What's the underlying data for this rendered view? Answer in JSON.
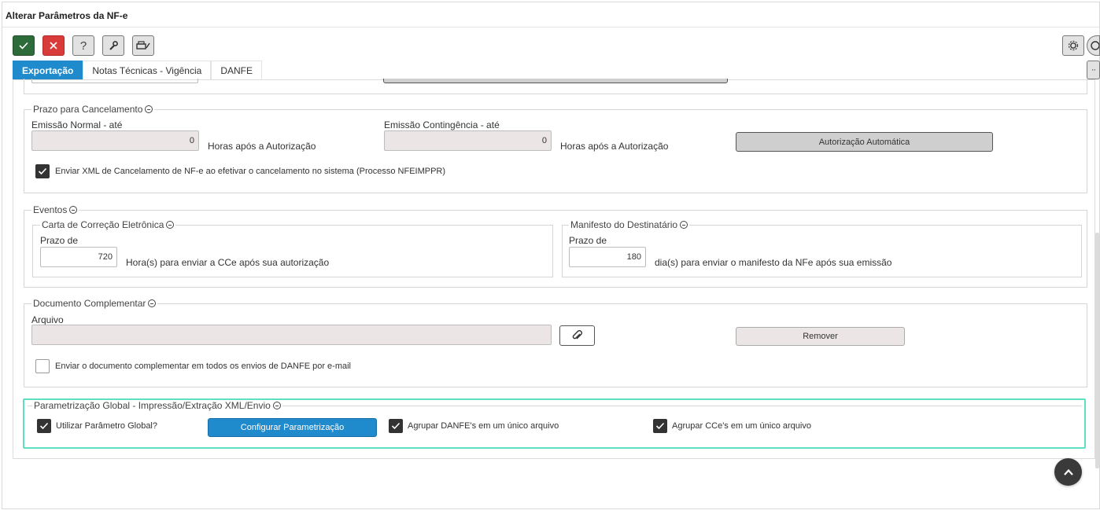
{
  "window": {
    "title": "Alterar Parâmetros da NF-e"
  },
  "toolbar": {
    "help_label": "?",
    "icons": [
      "check-icon",
      "close-icon",
      "help-icon",
      "wrench-icon",
      "printer-icon",
      "gear-icon",
      "search-icon",
      "more-icon"
    ]
  },
  "tabs": [
    {
      "label": "Exportação",
      "active": true
    },
    {
      "label": "Notas Técnicas - Vigência",
      "active": false
    },
    {
      "label": "DANFE",
      "active": false
    }
  ],
  "cancelamento": {
    "legend": "Prazo para Cancelamento",
    "normal_label": "Emissão Normal - até",
    "normal_value": "0",
    "normal_suffix": "Horas após a Autorização",
    "contingencia_label": "Emissão Contingência - até",
    "contingencia_value": "0",
    "contingencia_suffix": "Horas após a Autorização",
    "auto_button": "Autorização Automática",
    "xml_checkbox_label": "Enviar XML de Cancelamento de NF-e ao efetivar o cancelamento no sistema (Processo NFEIMPPR)",
    "xml_checkbox_checked": true
  },
  "eventos": {
    "legend": "Eventos",
    "cce": {
      "legend": "Carta de Correção Eletrônica",
      "prazo_label": "Prazo de",
      "prazo_value": "720",
      "suffix": "Hora(s) para enviar a CCe após sua autorização"
    },
    "manifesto": {
      "legend": "Manifesto do Destinatário",
      "prazo_label": "Prazo de",
      "prazo_value": "180",
      "suffix": "dia(s) para enviar o manifesto da NFe após sua emissão"
    }
  },
  "documento": {
    "legend": "Documento Complementar",
    "arquivo_label": "Arquivo",
    "arquivo_value": "",
    "remove_button": "Remover",
    "email_checkbox_label": "Enviar o documento complementar em todos os envios de DANFE por e-mail",
    "email_checkbox_checked": false
  },
  "global": {
    "legend": "Parametrização Global - Impressão/Extração XML/Envio",
    "use_global_label": "Utilizar Parâmetro Global?",
    "use_global_checked": true,
    "config_button": "Configurar Parametrização",
    "agrupar_danfe_label": "Agrupar DANFE's em um único arquivo",
    "agrupar_danfe_checked": true,
    "agrupar_cce_label": "Agrupar CCe's em um único arquivo",
    "agrupar_cce_checked": true
  },
  "colors": {
    "accent": "#1f8bcd",
    "confirm": "#2e6b3a",
    "cancel": "#d93a3a",
    "highlight_border": "#5fe0c3"
  }
}
